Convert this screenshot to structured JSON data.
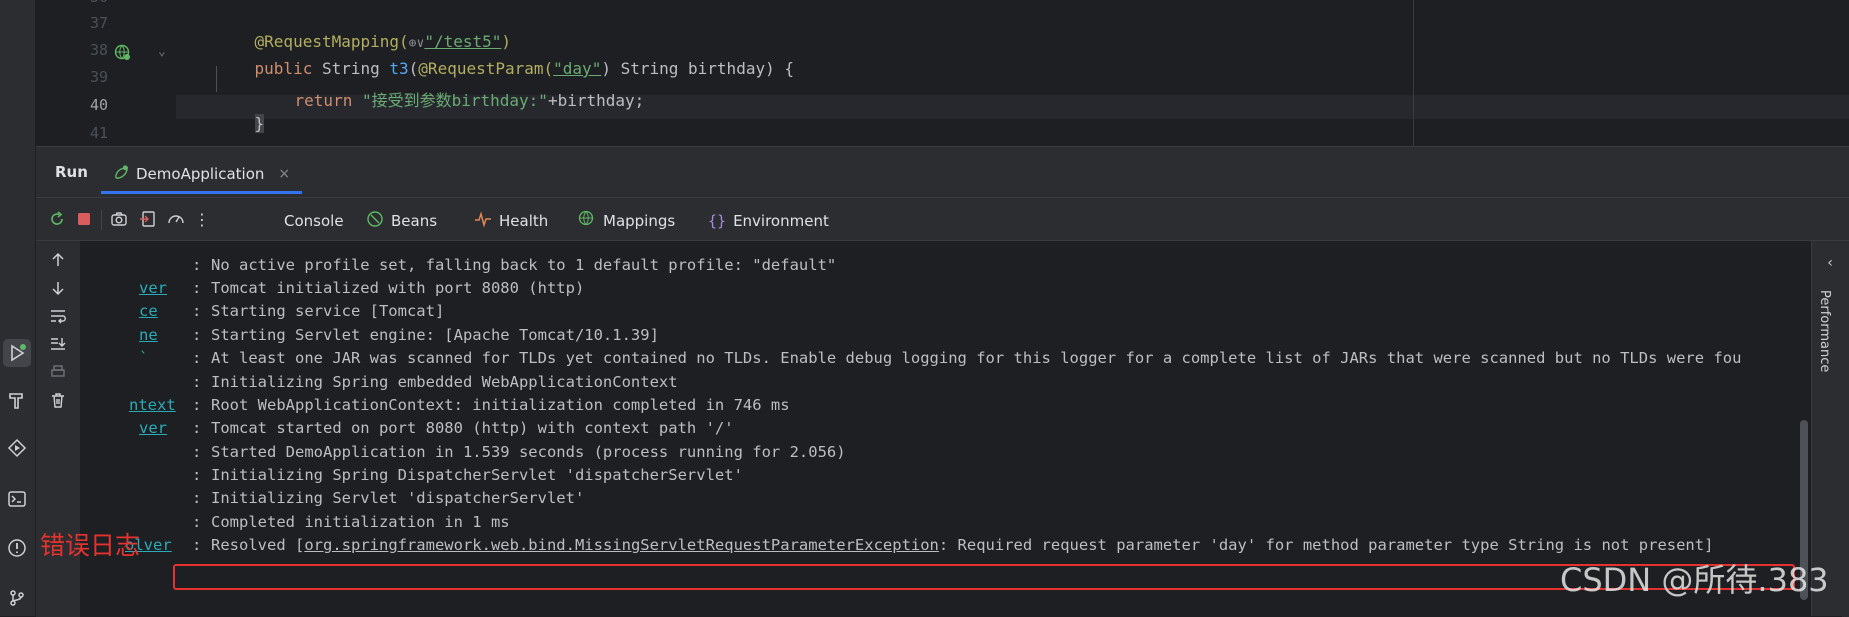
{
  "editor": {
    "lines": [
      {
        "num": "37"
      },
      {
        "num": "38"
      },
      {
        "num": "39"
      },
      {
        "num": "40"
      },
      {
        "num": "41"
      }
    ],
    "code": {
      "l37_annotation": "@RequestMapping(",
      "l37_globe": "⊕∨",
      "l37_path": "\"/test5\"",
      "l37_close": ")",
      "l38_public": "public",
      "l38_type": " String ",
      "l38_method": "t3",
      "l38_paren": "(",
      "l38_annotation": "@RequestParam(",
      "l38_param": "\"day\"",
      "l38_rest": ") String birthday) {",
      "l39_return": "return",
      "l39_string": " \"接受到参数birthday:\"",
      "l39_rest": "+birthday;",
      "l40_brace": "}"
    }
  },
  "run": {
    "title": "Run",
    "tab_label": "DemoApplication",
    "tab_close": "×",
    "toolbar_tabs": {
      "console": "Console",
      "beans": "Beans",
      "health": "Health",
      "mappings": "Mappings",
      "environment": "Environment"
    },
    "more": "⋮"
  },
  "console": {
    "lines": [
      {
        "src": "",
        "sep": ":",
        "msg": "No active profile set, falling back to 1 default profile: \"default\""
      },
      {
        "src": "ver",
        "sep": ":",
        "msg": "Tomcat initialized with port 8080 (http)"
      },
      {
        "src": "ce",
        "sep": ":",
        "msg": "Starting service [Tomcat]"
      },
      {
        "src": "ne",
        "sep": ":",
        "msg": "Starting Servlet engine: [Apache Tomcat/10.1.39]"
      },
      {
        "src": "`",
        "sep": ":",
        "msg": "At least one JAR was scanned for TLDs yet contained no TLDs. Enable debug logging for this logger for a complete list of JARs that were scanned but no TLDs were fou"
      },
      {
        "src": "",
        "sep": ":",
        "msg": "Initializing Spring embedded WebApplicationContext"
      },
      {
        "src": "ntext",
        "sep": ":",
        "msg": "Root WebApplicationContext: initialization completed in 746 ms"
      },
      {
        "src": "ver",
        "sep": ":",
        "msg": "Tomcat started on port 8080 (http) with context path '/'"
      },
      {
        "src": "",
        "sep": ":",
        "msg": "Started DemoApplication in 1.539 seconds (process running for 2.056)"
      },
      {
        "src": "",
        "sep": ":",
        "msg": "Initializing Spring DispatcherServlet 'dispatcherServlet'"
      },
      {
        "src": "",
        "sep": ":",
        "msg": "Initializing Servlet 'dispatcherServlet'"
      },
      {
        "src": "",
        "sep": ":",
        "msg": "Completed initialization in 1 ms"
      }
    ],
    "error_line": {
      "src": "olver",
      "sep": ":",
      "prefix": "Resolved [",
      "exception": "org.springframework.web.bind.MissingServletRequestParameterException",
      "rest": ": Required request parameter 'day' for method parameter type String is not present]"
    },
    "error_annotation": "错误日志"
  },
  "right_panel": {
    "label": "Performance"
  },
  "watermark": "CSDN @所待.383",
  "colors": {
    "accent": "#3574f0",
    "error_box": "#e5322e",
    "background": "#1e1f22",
    "panel": "#2b2d30"
  }
}
